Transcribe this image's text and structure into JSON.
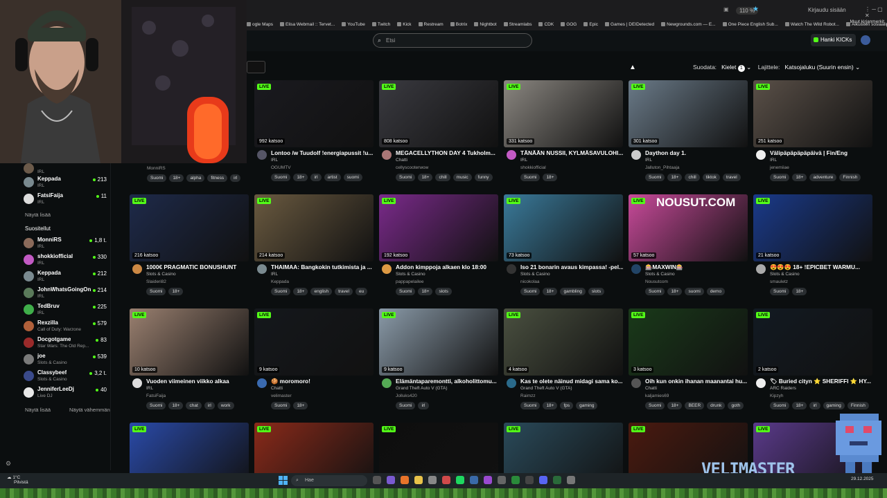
{
  "browser": {
    "zoom": "110 %",
    "signin": "Kirjaudu sisään",
    "bookmarks": [
      "ogle Maps",
      "Elisa Webmail :: Tervet...",
      "YouTube",
      "Twitch",
      "Kick",
      "Restream",
      "Botrix",
      "Nightbot",
      "Streamlabs",
      "CDK",
      "GOG",
      "Epic",
      "Games | DEIDetected",
      "Newgrounds.com — E...",
      "One Piece English Sub...",
      "Watch The Wild Robot...",
      "Aikuisten sosiaalipalve..."
    ],
    "other_bookmarks": "Muut kirjanmerkit"
  },
  "header": {
    "search_placeholder": "Etsi",
    "kicks_button": "Hanki KICKs"
  },
  "filters": {
    "filter_label": "Suodata:",
    "lang_label": "Kielet",
    "lang_count": "1",
    "sort_label": "Lajittele:",
    "sort_value": "Katsojaluku (Suurin ensin)"
  },
  "sidebar": {
    "top_items": [
      {
        "name": "",
        "category": "IRL",
        "viewers": "",
        "color": "#6b5a4a"
      },
      {
        "name": "Keppada",
        "category": "IRL",
        "viewers": "213",
        "color": "#7a8a90"
      },
      {
        "name": "FatsiFaija",
        "category": "IRL",
        "viewers": "11",
        "color": "#ddd"
      }
    ],
    "show_more_1": "Näytä lisää",
    "followed_title": "Suositellut",
    "followed": [
      {
        "name": "MonniRS",
        "category": "IRL",
        "viewers": "1,8 t.",
        "color": "#8a6a5a"
      },
      {
        "name": "shokkiofficial",
        "category": "IRL",
        "viewers": "330",
        "color": "#c25ac4"
      },
      {
        "name": "Keppada",
        "category": "IRL",
        "viewers": "212",
        "color": "#7a8a90"
      },
      {
        "name": "JohnWhatsGoingOn",
        "category": "IRL",
        "viewers": "214",
        "color": "#5a7a5a"
      },
      {
        "name": "TedBruv",
        "category": "IRL",
        "viewers": "225",
        "color": "#3fae4a"
      },
      {
        "name": "Rexzilla",
        "category": "Call of Duty: Warzone",
        "viewers": "579",
        "color": "#b0603a"
      },
      {
        "name": "Docgotgame",
        "category": "Star Wars: The Old Rep...",
        "viewers": "83",
        "color": "#9a2a2a"
      },
      {
        "name": "joe",
        "category": "Slots & Casino",
        "viewers": "539",
        "color": "#7a7a7a"
      },
      {
        "name": "Classybeef",
        "category": "Slots & Casino",
        "viewers": "3,2 t.",
        "color": "#3a4a8a"
      },
      {
        "name": "JenniferLeeDj",
        "category": "Live DJ",
        "viewers": "40",
        "color": "#e8e8e8"
      }
    ],
    "show_more_2": "Näytä lisää",
    "show_less": "Näytä vähemmän"
  },
  "streams_row0_partial": {
    "name": "MonniRS",
    "tags": [
      "Suomi",
      "18+",
      "alpha",
      "fitness",
      "irl"
    ]
  },
  "streams": [
    {
      "title": "Lontoo /w Tuudolf !energiapussit !u...",
      "category": "IRL",
      "channel": "OGUMTV",
      "viewers": "992 katsoo",
      "tags": [
        "Suomi",
        "18+",
        "irl",
        "artist",
        "suomi"
      ],
      "bg": "#1a1a1f",
      "av": "#556"
    },
    {
      "title": "MEGACELLYTHON DAY 4 Tukholm...",
      "category": "Chatti",
      "channel": "cellyscooterwow",
      "viewers": "808 katsoo",
      "tags": [
        "Suomi",
        "18+",
        "chill",
        "music",
        "funny"
      ],
      "bg": "#3a3a40",
      "av": "#a77"
    },
    {
      "title": "TÄNÄÄN NUSSII, KYLMÄSAVULOHI...",
      "category": "IRL",
      "channel": "shokkiofficial",
      "viewers": "331 katsoo",
      "tags": [
        "Suomi",
        "18+"
      ],
      "bg": "#8a8680",
      "av": "#c25ac4"
    },
    {
      "title": "Daython day 1.",
      "category": "IRL",
      "channel": "Jalluton_Pihtaaja",
      "viewers": "301 katsoo",
      "tags": [
        "Suomi",
        "18+",
        "chill",
        "tiktok",
        "travel"
      ],
      "bg": "#6a7a88",
      "av": "#ccc"
    },
    {
      "title": "Välipäpäpäpäpäivä | Fin/Eng",
      "category": "IRL",
      "channel": "jenemiiae",
      "viewers": "251 katsoo",
      "tags": [
        "Suomi",
        "18+",
        "adventure",
        "Finnish"
      ],
      "bg": "#5a5048",
      "av": "#eee"
    },
    {
      "title": "1000€ PRAGMATIC BONUSHUNT",
      "category": "Slots & Casino",
      "channel": "Slaideri82",
      "viewers": "216 katsoo",
      "tags": [
        "Suomi",
        "18+"
      ],
      "bg": "#1e2a4a",
      "av": "#c84"
    },
    {
      "title": "THAIMAA: Bangkokin tutkimista ja ...",
      "category": "IRL",
      "channel": "Keppada",
      "viewers": "214 katsoo",
      "tags": [
        "Suomi",
        "18+",
        "english",
        "travel",
        "eu"
      ],
      "bg": "#6a5a40",
      "av": "#7a8a90"
    },
    {
      "title": "Addon kimppoja alkaen klo 18:00",
      "category": "Slots & Casino",
      "channel": "pappapelailee",
      "viewers": "192 katsoo",
      "tags": [
        "Suomi",
        "18+",
        "slots"
      ],
      "bg": "#7a2a8a",
      "av": "#d94"
    },
    {
      "title": "Iso 21 bonarin avaus kimpassa! -pel...",
      "category": "Slots & Casino",
      "channel": "nicokolaa",
      "viewers": "73 katsoo",
      "tags": [
        "Suomi",
        "18+",
        "gambling",
        "slots"
      ],
      "bg": "#3a7a9a",
      "av": "#333"
    },
    {
      "title": "🎰MAXWIN🎰",
      "category": "Slots & Casino",
      "channel": "Nousutcom",
      "viewers": "57 katsoo",
      "overlay": "NOUSUT.COM",
      "tags": [
        "Suomi",
        "18+",
        "suomi",
        "demo"
      ],
      "bg": "#c84a9a",
      "av": "#246"
    },
    {
      "title": "😍😍😍 18+ !EPICBET WARMU...",
      "category": "Slots & Casino",
      "channel": "smauletz",
      "viewers": "21 katsoo",
      "tags": [
        "Suomi",
        "18+"
      ],
      "bg": "#1a3a8a",
      "av": "#aaa"
    },
    {
      "title": "Vuoden viimeinen viikko alkaa",
      "category": "IRL",
      "channel": "FatsiFaija",
      "viewers": "10 katsoo",
      "tags": [
        "Suomi",
        "18+",
        "chat",
        "irl",
        "work"
      ],
      "bg": "#9a8070",
      "av": "#ddd"
    },
    {
      "title": "🍪 moromoro!",
      "category": "Chatti",
      "channel": "velimaster",
      "viewers": "9 katsoo",
      "tags": [
        "Suomi",
        "18+"
      ],
      "bg": "#15181c",
      "av": "#3a6ab0"
    },
    {
      "title": "Elämäntaparemontti, alkoholittomu...",
      "category": "Grand Theft Auto V (GTA)",
      "channel": "Jolluks420",
      "viewers": "9 katsoo",
      "tags": [
        "Suomi",
        "irl"
      ],
      "bg": "#8a9aa8",
      "av": "#5a5"
    },
    {
      "title": "Kas te olete näinud midagi sama ko...",
      "category": "Grand Theft Auto V (GTA)",
      "channel": "Raimzz",
      "viewers": "4 katsoo",
      "tags": [
        "Suomi",
        "18+",
        "fps",
        "gaming"
      ],
      "bg": "#4a5040",
      "av": "#2a6a8a"
    },
    {
      "title": "Oih kun onkin ihanan maanantai hu...",
      "category": "Chatti",
      "channel": "kaljamies69",
      "viewers": "3 katsoo",
      "tags": [
        "Suomi",
        "18+",
        "BEER",
        "drunk",
        "goth"
      ],
      "bg": "#1a3a1a",
      "av": "#555"
    },
    {
      "title": "🏷 Buried cityn ⭐ SHERIFFI ⭐ HY...",
      "category": "ARC Raiders",
      "channel": "Kipzyh",
      "viewers": "2 katsoo",
      "tags": [
        "Suomi",
        "18+",
        "irl",
        "gaming",
        "Finnish"
      ],
      "bg": "#121a22",
      "av": "#eee"
    },
    {
      "title": "",
      "category": "",
      "channel": "",
      "viewers": "",
      "tags": [],
      "bg": "#2a4aa8",
      "av": ""
    },
    {
      "title": "",
      "category": "",
      "channel": "",
      "viewers": "",
      "tags": [],
      "bg": "#8a2a1a",
      "av": ""
    },
    {
      "title": "",
      "category": "",
      "channel": "",
      "viewers": "",
      "tags": [],
      "bg": "#0e0e0e",
      "av": ""
    },
    {
      "title": "",
      "category": "",
      "channel": "",
      "viewers": "",
      "tags": [],
      "bg": "#2a4a5a",
      "av": ""
    },
    {
      "title": "",
      "category": "",
      "channel": "",
      "viewers": "",
      "tags": [],
      "bg": "#4a1a10",
      "av": ""
    },
    {
      "title": "",
      "category": "",
      "channel": "",
      "viewers": "",
      "tags": [],
      "bg": "#5a3a8a",
      "av": ""
    }
  ],
  "live_label": "LIVE",
  "taskbar": {
    "weather_temp": "1°C",
    "weather_text": "Pilvistä",
    "search": "Hae",
    "date": "29.12.2025"
  },
  "overlay": {
    "brand": "VELIMASTER"
  }
}
